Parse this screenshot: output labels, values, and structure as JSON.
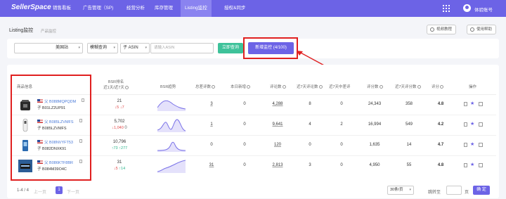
{
  "brand": {
    "logo": "SellerSpace",
    "accent": "#6c63e6",
    "alert": "#e02020"
  },
  "nav": {
    "items": [
      {
        "label": "销售看板"
      },
      {
        "label": "广告管理（SP)"
      },
      {
        "label": "经营分析"
      },
      {
        "label": "库存管理"
      },
      {
        "label": "Listing监控",
        "active": true
      },
      {
        "label": "授权&同步"
      }
    ],
    "apps_icon": "grid-icon",
    "user": {
      "name": "体验账号",
      "icon": "user-icon"
    }
  },
  "page": {
    "title": "Listing监控",
    "subtitle": "产品监控",
    "video_tutorial": "视频教程",
    "help": "使用帮助"
  },
  "filter": {
    "marketplace_placeholder": "",
    "marketplace": "美国站",
    "query_mode": "模糊查询",
    "id_type": "子 ASIN",
    "search_placeholder": "请输入ASIN",
    "query_button": "立即查询",
    "new_monitor_button": "新增监控 (4/100)"
  },
  "table": {
    "headers": {
      "product": "商品信息",
      "bsr_line1": "BSR排名",
      "bsr_line2": "近1天/近7天",
      "bsr_trend": "BSR趋势",
      "total_reviews": "总差评数",
      "new_today": "本日新增",
      "review_count": "评论数",
      "new_reviews_7d": "近7天评论数",
      "bad_reviews_7d": "近7天中差评",
      "rating_count": "评分数",
      "new_ratings_7d": "近7天评分数",
      "rating": "评分",
      "action": "操作"
    },
    "rows": [
      {
        "parent_asin": "父 B088MQPQDM",
        "child_asin": "子 B01LZ2UP91",
        "bsr": "21",
        "bsr_1d": "↓5",
        "bsr_7d": "↓7",
        "total_bad": "3",
        "new_today": "0",
        "reviews": "4,288",
        "reviews_7d": "8",
        "bad_7d": "0",
        "ratings": "24,343",
        "ratings_7d": "358",
        "score": "4.8"
      },
      {
        "parent_asin": "父 B085LZVMFS",
        "child_asin": "子 B085LZVMFS",
        "bsr": "5,702",
        "bsr_1d": "↓1,040",
        "bsr_7d": "0",
        "total_bad": "1",
        "new_today": "0",
        "reviews": "9,641",
        "reviews_7d": "4",
        "bad_7d": "2",
        "ratings": "16,994",
        "ratings_7d": "549",
        "score": "4.2"
      },
      {
        "parent_asin": "父 B08NVYFT53",
        "child_asin": "子 B082DNXK91",
        "bsr": "10,796",
        "bsr_1d": "↑73",
        "bsr_7d": "↑277",
        "total_bad": "0",
        "new_today": "0",
        "reviews": "120",
        "reviews_7d": "0",
        "bad_7d": "0",
        "ratings": "1,635",
        "ratings_7d": "14",
        "score": "4.7"
      },
      {
        "parent_asin": "父 B086KTF8BR",
        "child_asin": "子 B084M39O4C",
        "bsr": "31",
        "bsr_1d": "↓5",
        "bsr_7d": "↑14",
        "total_bad": "31",
        "new_today": "0",
        "reviews": "2,813",
        "reviews_7d": "3",
        "bad_7d": "0",
        "ratings": "4,950",
        "ratings_7d": "55",
        "score": "4.8"
      }
    ]
  },
  "pagination": {
    "summary": "1-4 / 4",
    "prev": "上一页",
    "current": "1",
    "next": "下一页",
    "page_size": "30条/页",
    "jump_label": "跳转至",
    "page_unit": "页",
    "confirm": "确 定"
  }
}
